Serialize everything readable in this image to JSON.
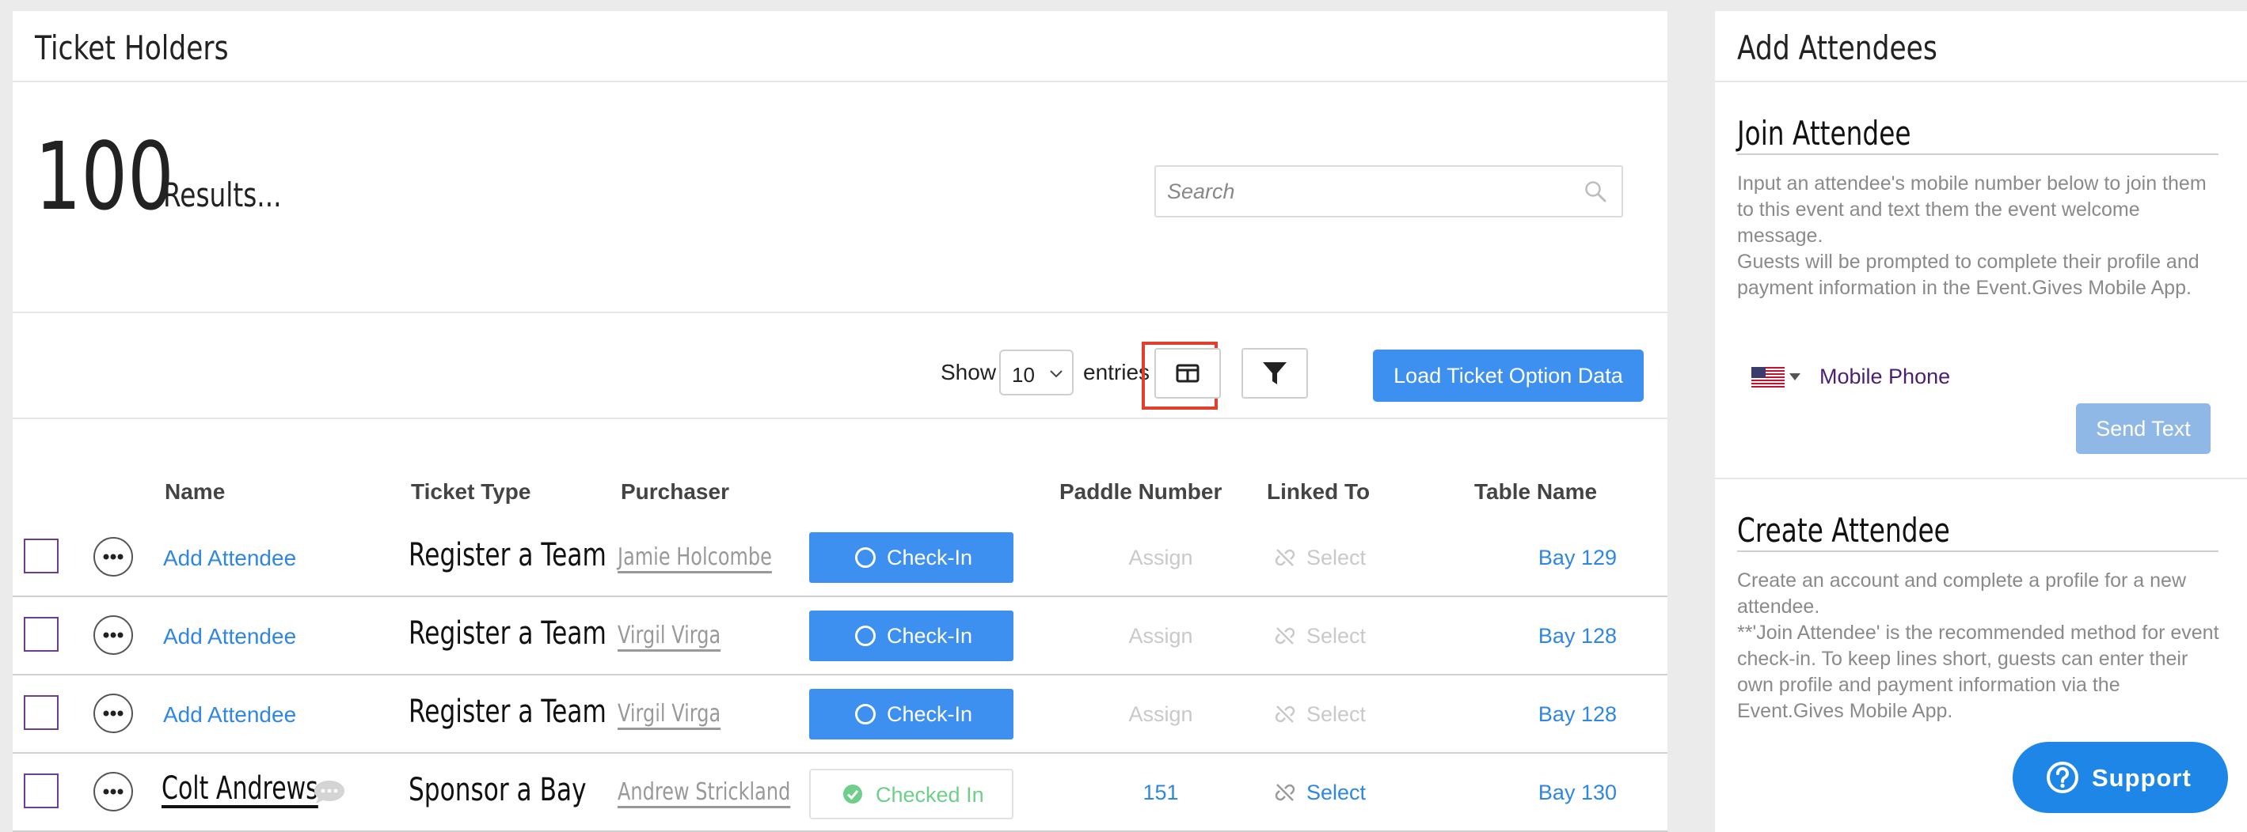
{
  "ticket_holders": {
    "title": "Ticket Holders",
    "count": "100",
    "results_label": "Results...",
    "search": {
      "placeholder": "Search"
    },
    "toolbar": {
      "show_label": "Show",
      "entries_value": "10",
      "entries_label": "entries",
      "load_button": "Load Ticket Option Data"
    },
    "columns": {
      "name": "Name",
      "ticket_type": "Ticket Type",
      "purchaser": "Purchaser",
      "paddle_number": "Paddle Number",
      "linked_to": "Linked To",
      "table_name": "Table Name"
    },
    "rows": [
      {
        "name": "Add Attendee",
        "ticket_type": "Register a Team",
        "purchaser": "Jamie Holcombe",
        "checkin": "Check-In",
        "paddle": "Assign",
        "linked": "Select",
        "table": "Bay 129"
      },
      {
        "name": "Add Attendee",
        "ticket_type": "Register a Team",
        "purchaser": "Virgil Virga",
        "checkin": "Check-In",
        "paddle": "Assign",
        "linked": "Select",
        "table": "Bay 128"
      },
      {
        "name": "Add Attendee",
        "ticket_type": "Register a Team",
        "purchaser": "Virgil Virga",
        "checkin": "Check-In",
        "paddle": "Assign",
        "linked": "Select",
        "table": "Bay 128"
      },
      {
        "name": "Colt Andrews",
        "ticket_type": "Sponsor a Bay",
        "purchaser": "Andrew Strickland",
        "checkin": "Checked In",
        "paddle": "151",
        "linked": "Select",
        "table": "Bay 130"
      }
    ]
  },
  "add_attendees": {
    "title": "Add Attendees",
    "join": {
      "heading": "Join Attendee",
      "description_1": "Input an attendee's mobile number below to join them to this event and text them the event welcome message.",
      "description_2": "Guests will be prompted to complete their profile and payment information in the Event.Gives Mobile App.",
      "phone_placeholder": "Mobile Phone",
      "send_button": "Send Text"
    },
    "create": {
      "heading": "Create Attendee",
      "description_1": "Create an account and complete a profile for a new attendee.",
      "description_2": "**'Join Attendee' is the recommended method for event check-in. To keep lines short, guests can enter their own profile and payment information via the Event.Gives Mobile App."
    }
  },
  "support": {
    "label": "Support"
  },
  "colors": {
    "primary_blue": "#3d8ff0",
    "link_blue": "#2f86e3",
    "checked_green": "#6fcf8a",
    "highlight_red": "#e0412c",
    "checkbox_purple": "#6b3d96"
  }
}
